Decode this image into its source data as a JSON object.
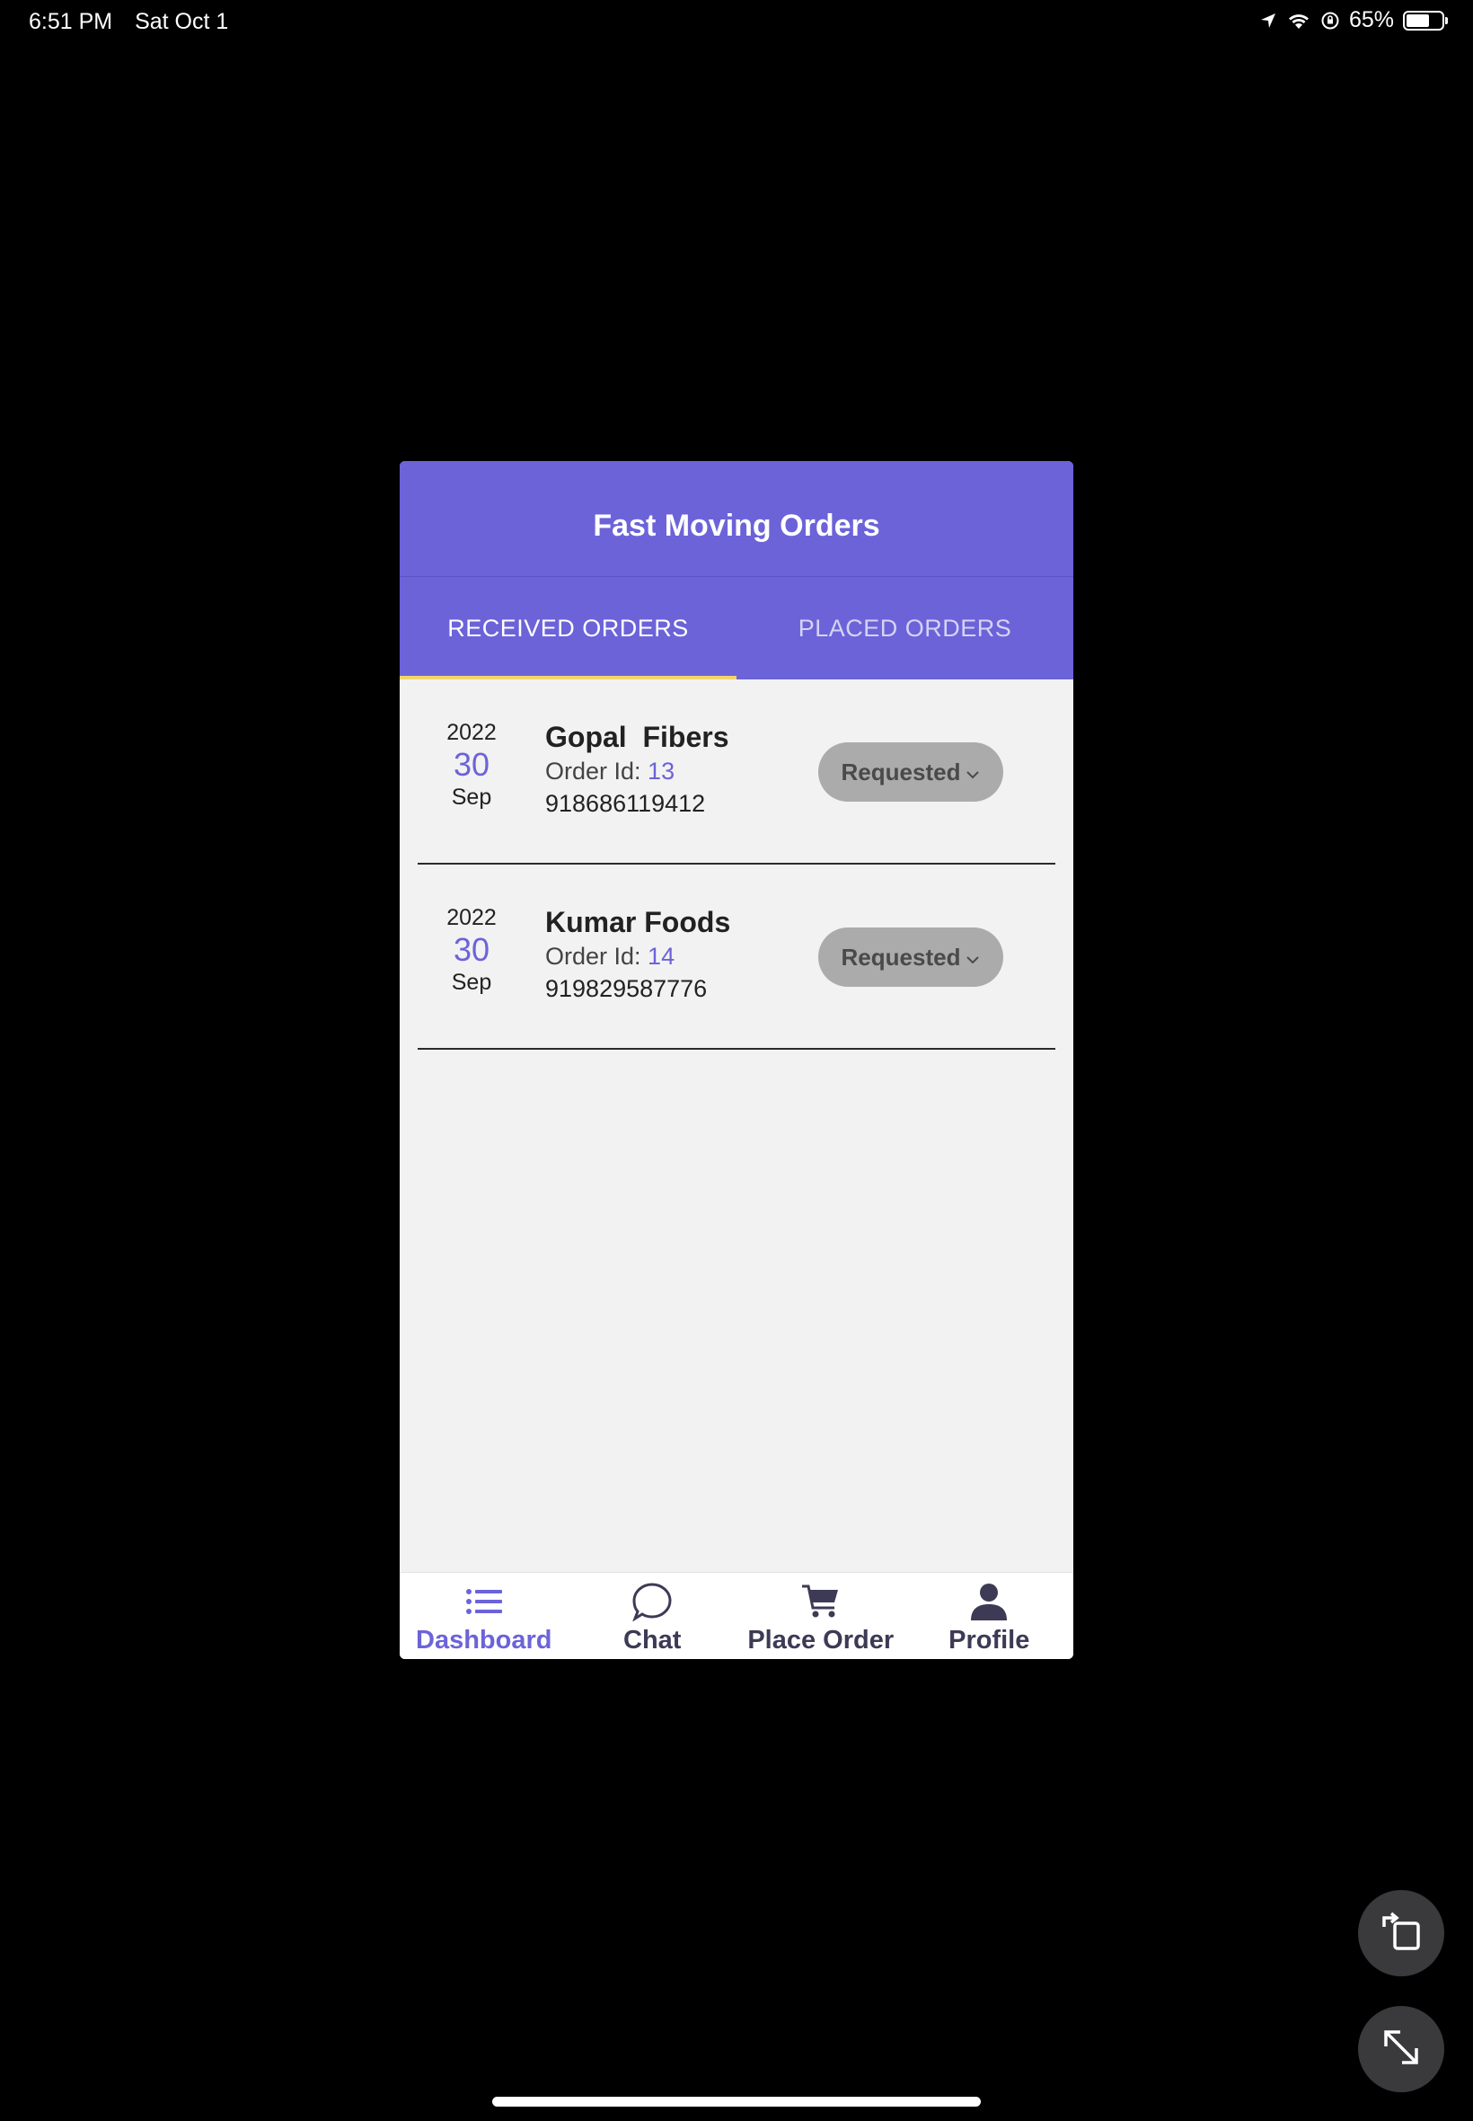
{
  "status_bar": {
    "time": "6:51 PM",
    "date": "Sat Oct 1",
    "battery_percent_text": "65%",
    "battery_level": 0.65
  },
  "app": {
    "title": "Fast Moving Orders",
    "tabs": [
      {
        "label": "RECEIVED ORDERS",
        "active": true
      },
      {
        "label": "PLACED ORDERS",
        "active": false
      }
    ],
    "orders": [
      {
        "year": "2022",
        "day": "30",
        "month": "Sep",
        "company": "Gopal  Fibers",
        "order_id_label": "Order Id: ",
        "order_id": "13",
        "phone": "918686119412",
        "status": "Requested"
      },
      {
        "year": "2022",
        "day": "30",
        "month": "Sep",
        "company": "Kumar Foods",
        "order_id_label": "Order Id: ",
        "order_id": "14",
        "phone": "919829587776",
        "status": "Requested"
      }
    ],
    "nav": [
      {
        "label": "Dashboard",
        "icon": "list-icon",
        "active": true
      },
      {
        "label": "Chat",
        "icon": "chat-bubble-icon",
        "active": false
      },
      {
        "label": "Place Order",
        "icon": "cart-icon",
        "active": false
      },
      {
        "label": "Profile",
        "icon": "person-icon",
        "active": false
      }
    ]
  },
  "colors": {
    "accent": "#6c63d9",
    "tab_indicator": "#f2d46a",
    "status_pill": "#ababab",
    "background": "#000000",
    "content_bg": "#f2f2f2"
  },
  "floating_controls": [
    "rotate-icon",
    "expand-icon"
  ]
}
